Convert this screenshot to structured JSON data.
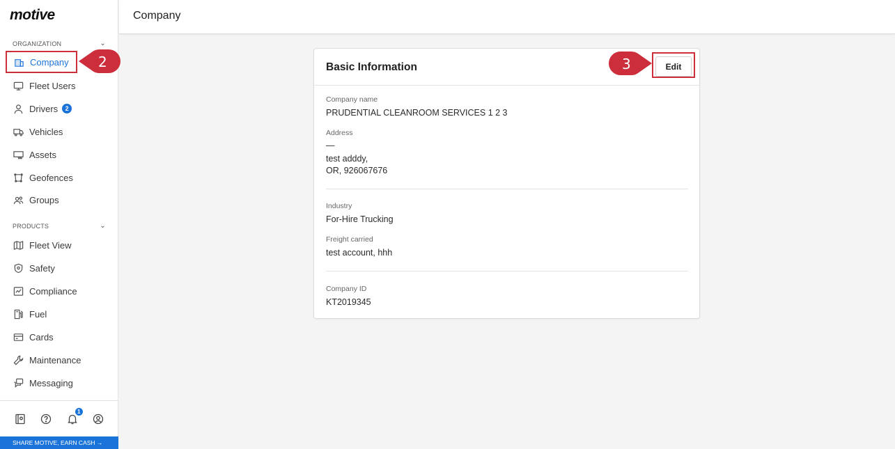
{
  "brand": {
    "logo_text": "motive"
  },
  "sidebar": {
    "organization_label": "ORGANIZATION",
    "products_label": "PRODUCTS",
    "org_items": [
      {
        "label": "Company",
        "icon": "building-icon",
        "active": true
      },
      {
        "label": "Fleet Users",
        "icon": "monitor-icon"
      },
      {
        "label": "Drivers",
        "icon": "person-icon",
        "badge": "2"
      },
      {
        "label": "Vehicles",
        "icon": "truck-icon"
      },
      {
        "label": "Assets",
        "icon": "trailer-icon"
      },
      {
        "label": "Geofences",
        "icon": "geofence-icon"
      },
      {
        "label": "Groups",
        "icon": "group-icon"
      }
    ],
    "product_items": [
      {
        "label": "Fleet View",
        "icon": "map-icon"
      },
      {
        "label": "Safety",
        "icon": "shield-icon"
      },
      {
        "label": "Compliance",
        "icon": "compliance-icon"
      },
      {
        "label": "Fuel",
        "icon": "fuel-icon"
      },
      {
        "label": "Cards",
        "icon": "card-icon"
      },
      {
        "label": "Maintenance",
        "icon": "wrench-icon"
      },
      {
        "label": "Messaging",
        "icon": "message-icon"
      }
    ],
    "footer": {
      "notification_count": "1"
    },
    "share_text": "SHARE MOTIVE, EARN CASH →"
  },
  "callouts": {
    "step_company": "2",
    "step_edit": "3"
  },
  "header": {
    "title": "Company"
  },
  "card": {
    "title": "Basic Information",
    "edit_label": "Edit",
    "fields": {
      "company_name_label": "Company name",
      "company_name": "PRUDENTIAL CLEANROOM SERVICES 1 2 3",
      "address_label": "Address",
      "address_line1": "—",
      "address_line2": "test adddy,",
      "address_line3": "OR, 926067676",
      "industry_label": "Industry",
      "industry": "For-Hire Trucking",
      "freight_label": "Freight carried",
      "freight": "test account, hhh",
      "company_id_label": "Company ID",
      "company_id": "KT2019345"
    }
  },
  "colors": {
    "accent": "#1a73d9",
    "callout": "#cc2e3b"
  }
}
